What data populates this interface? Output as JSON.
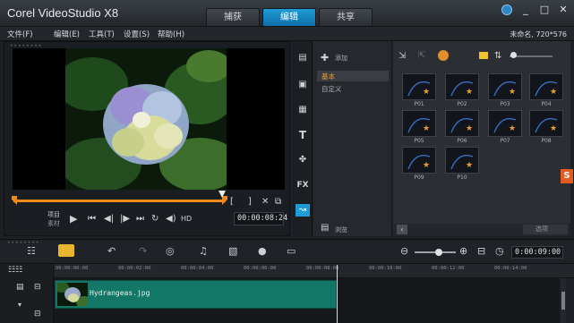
{
  "app": {
    "title": "Corel VideoStudio X8",
    "steps": [
      "捕获",
      "编辑",
      "共享"
    ],
    "active_step": "编辑"
  },
  "menu": {
    "items": [
      "文件(F)",
      "编辑(E)",
      "工具(T)",
      "设置(S)",
      "帮助(H)"
    ],
    "project_info": "未命名, 720*576"
  },
  "player": {
    "mode_project": "项目",
    "mode_clip": "素材",
    "hd_label": "HD",
    "timecode": "00:00:08:24",
    "mark_in": "[",
    "mark_out": "]"
  },
  "library": {
    "add_label": "添加",
    "categories": [
      "基本",
      "自定义"
    ],
    "selected_category": "基本",
    "footer_label": "浏览",
    "footer_right": "选项",
    "thumbnails": [
      "P01",
      "P02",
      "P03",
      "P04",
      "P05",
      "P06",
      "P07",
      "P08",
      "P09",
      "P10"
    ]
  },
  "timeline": {
    "timecode": "0:00:09:00",
    "ruler_ticks": [
      "00:00:00:00",
      "00:00:02:00",
      "00:00:04:00",
      "00:00:06:00",
      "00:00:08:00",
      "00:00:10:00",
      "00:00:12:00",
      "00:00:14:00"
    ],
    "clip": {
      "name": "Hydrangeas.jpg"
    }
  },
  "colors": {
    "accent": "#1f9bd6",
    "clip": "#127766",
    "trim": "#f28a1a"
  }
}
